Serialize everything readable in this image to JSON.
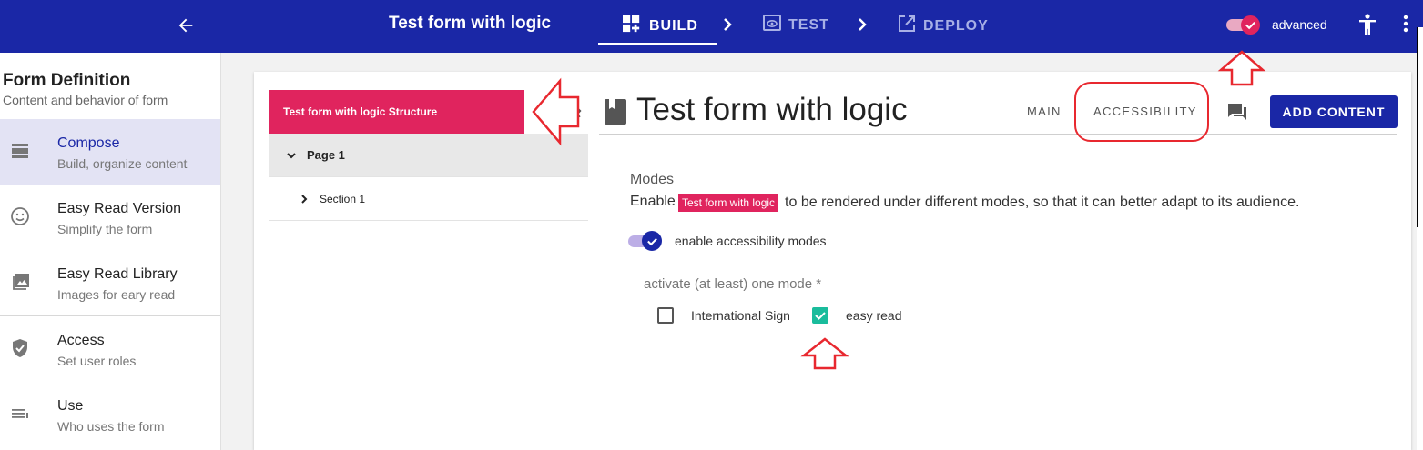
{
  "topbar": {
    "title": "Test form with logic",
    "steps": [
      {
        "label": "BUILD",
        "icon": "build-icon",
        "active": true
      },
      {
        "label": "TEST",
        "icon": "preview-icon",
        "active": false
      },
      {
        "label": "DEPLOY",
        "icon": "open-external-icon",
        "active": false
      }
    ],
    "advanced_label": "advanced",
    "advanced_on": true,
    "colors": {
      "bar": "#1a27a6",
      "accent": "#e0245e"
    }
  },
  "sidenav": {
    "title": "Form Definition",
    "subtitle": "Content and behavior of form",
    "items": [
      {
        "label": "Compose",
        "desc": "Build, organize content",
        "icon": "compose-icon",
        "active": true
      },
      {
        "label": "Easy Read Version",
        "desc": "Simplify the form",
        "icon": "smiley-icon",
        "active": false
      },
      {
        "label": "Easy Read Library",
        "desc": "Images for eary read",
        "icon": "image-library-icon",
        "active": false
      },
      {
        "label": "Access",
        "desc": "Set user roles",
        "icon": "shield-check-icon",
        "active": false
      },
      {
        "label": "Use",
        "desc": "Who uses the form",
        "icon": "list-icon",
        "active": false
      }
    ]
  },
  "tree": {
    "header": "Test form with logic Structure",
    "page": "Page 1",
    "section": "Section 1"
  },
  "form": {
    "title": "Test form with logic",
    "tabs": [
      "MAIN",
      "ACCESSIBILITY"
    ],
    "add_label": "ADD CONTENT"
  },
  "modes": {
    "heading": "Modes",
    "desc_prefix": "Enable",
    "chip": "Test form with logic",
    "desc_suffix": "to be rendered under different modes, so that it can better adapt to its audience.",
    "toggle_label": "enable accessibility modes",
    "toggle_on": true,
    "group_label": "activate (at least) one mode *",
    "options": [
      {
        "label": "International Sign",
        "checked": false
      },
      {
        "label": "easy read",
        "checked": true
      }
    ],
    "check_color": "#1abc9c"
  }
}
